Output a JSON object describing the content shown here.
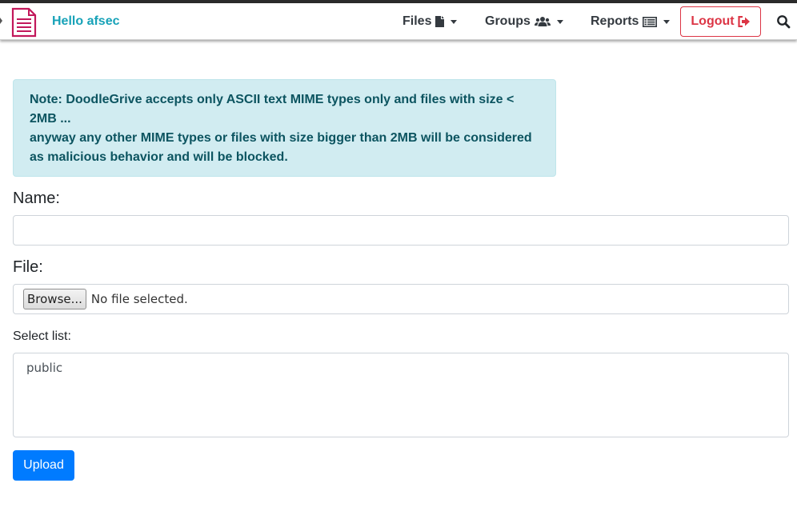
{
  "navbar": {
    "brand_text": "Hello afsec",
    "files_label": "Files",
    "groups_label": "Groups",
    "reports_label": "Reports",
    "logout_label": "Logout",
    "icons": {
      "brand": "document-logo-icon",
      "files": "file-icon",
      "groups": "users-icon",
      "reports": "list-icon",
      "logout": "sign-out-icon",
      "search": "search-icon"
    },
    "colors": {
      "brand": "#17a2b8",
      "logout": "#dc3545",
      "logo": "#c2185b"
    }
  },
  "alert": {
    "line1": "Note: DoodleGrive accepts only ASCII text MIME types only and files with size < 2MB ...",
    "line2": "anyway any other MIME types or files with size bigger than 2MB will be considered as malicious behavior and will be blocked."
  },
  "form": {
    "name_label": "Name:",
    "name_value": "",
    "file_label": "File:",
    "browse_label": "Browse...",
    "file_status": "No file selected.",
    "select_label": "Select list:",
    "select_options": [
      "public"
    ],
    "upload_label": "Upload",
    "upload_color": "#007bff"
  }
}
